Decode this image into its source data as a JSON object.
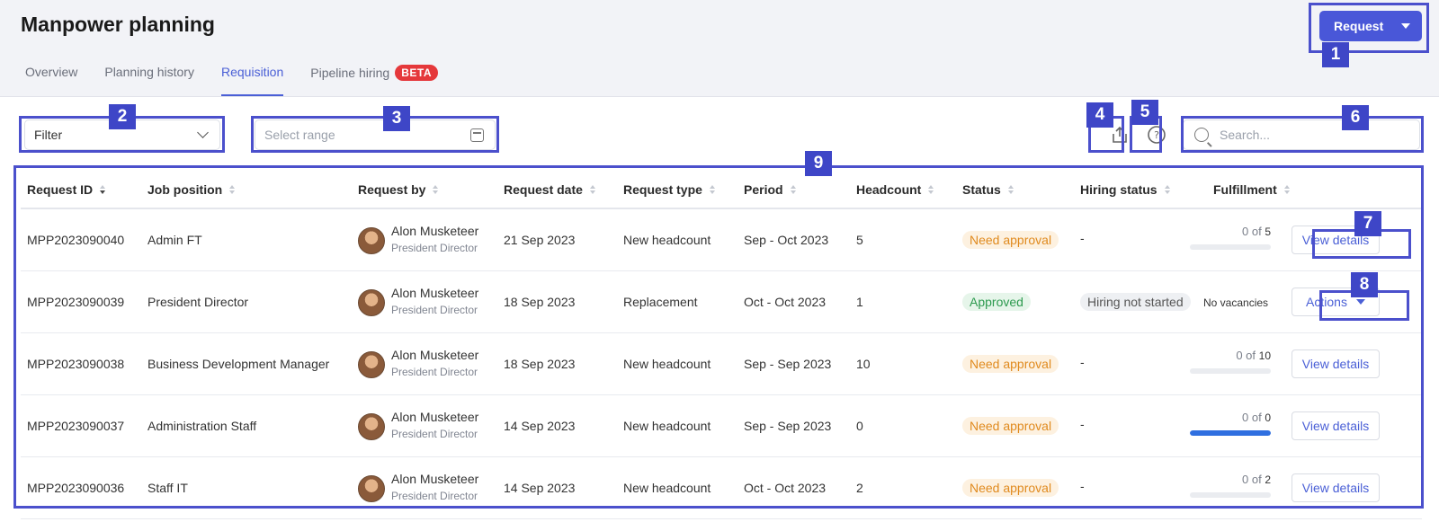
{
  "header": {
    "title": "Manpower planning",
    "request_label": "Request",
    "tabs": [
      {
        "label": "Overview"
      },
      {
        "label": "Planning history"
      },
      {
        "label": "Requisition"
      },
      {
        "label": "Pipeline hiring",
        "badge": "BETA"
      }
    ],
    "active_tab": "Requisition"
  },
  "toolbar": {
    "filter_label": "Filter",
    "range_placeholder": "Select range",
    "export_icon": "export-icon",
    "help_icon": "help-icon",
    "search_placeholder": "Search..."
  },
  "table": {
    "columns": [
      "Request ID",
      "Job position",
      "Request by",
      "Request date",
      "Request type",
      "Period",
      "Headcount",
      "Status",
      "Hiring status",
      "Fulfillment"
    ],
    "rows": [
      {
        "id": "MPP2023090040",
        "position": "Admin FT",
        "by_name": "Alon Musketeer",
        "by_title": "President Director",
        "date": "21 Sep 2023",
        "type": "New headcount",
        "period": "Sep - Oct 2023",
        "headcount": "5",
        "status": "Need approval",
        "hiring": "-",
        "fulfill_text": "0 of ",
        "fulfill_total": "5",
        "fulfill_pct": 0,
        "action": "View details"
      },
      {
        "id": "MPP2023090039",
        "position": "President Director",
        "by_name": "Alon Musketeer",
        "by_title": "President Director",
        "date": "18 Sep 2023",
        "type": "Replacement",
        "period": "Oct - Oct 2023",
        "headcount": "1",
        "status": "Approved",
        "hiring": "Hiring not started",
        "fulfill_note": "No vacancies",
        "action": "Actions"
      },
      {
        "id": "MPP2023090038",
        "position": "Business Development Manager",
        "by_name": "Alon Musketeer",
        "by_title": "President Director",
        "date": "18 Sep 2023",
        "type": "New headcount",
        "period": "Sep - Sep 2023",
        "headcount": "10",
        "status": "Need approval",
        "hiring": "-",
        "fulfill_text": "0 of ",
        "fulfill_total": "10",
        "fulfill_pct": 0,
        "action": "View details"
      },
      {
        "id": "MPP2023090037",
        "position": "Administration Staff",
        "by_name": "Alon Musketeer",
        "by_title": "President Director",
        "date": "14 Sep 2023",
        "type": "New headcount",
        "period": "Sep - Sep 2023",
        "headcount": "0",
        "status": "Need approval",
        "hiring": "-",
        "fulfill_text": "0 of ",
        "fulfill_total": "0",
        "fulfill_pct": 100,
        "action": "View details"
      },
      {
        "id": "MPP2023090036",
        "position": "Staff IT",
        "by_name": "Alon Musketeer",
        "by_title": "President Director",
        "date": "14 Sep 2023",
        "type": "New headcount",
        "period": "Oct - Oct 2023",
        "headcount": "2",
        "status": "Need approval",
        "hiring": "-",
        "fulfill_text": "0 of ",
        "fulfill_total": "2",
        "fulfill_pct": 0,
        "action": "View details"
      }
    ]
  },
  "markers": [
    "1",
    "2",
    "3",
    "4",
    "5",
    "6",
    "7",
    "8",
    "9"
  ],
  "colors": {
    "accent": "#4957d8",
    "marker": "#3e46c7",
    "beta": "#e5383b",
    "need_approval": "#e08a1e",
    "approved": "#2d9a4f"
  }
}
